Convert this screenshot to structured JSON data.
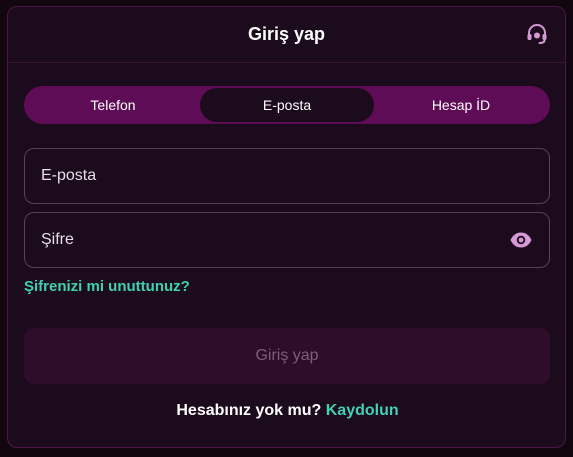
{
  "header": {
    "title": "Giriş yap",
    "support_icon": "headset-icon"
  },
  "tabs": [
    {
      "label": "Telefon",
      "active": false
    },
    {
      "label": "E-posta",
      "active": true
    },
    {
      "label": "Hesap İD",
      "active": false
    }
  ],
  "form": {
    "email_placeholder": "E-posta",
    "password_placeholder": "Şifre",
    "eye_icon": "eye-icon",
    "forgot_label": "Şifrenizi mi unuttunuz?",
    "submit_label": "Giriş yap"
  },
  "footer": {
    "prompt": "Hesabınız yok mu?",
    "link": "Kaydolun"
  },
  "colors": {
    "background": "#1c0a1d",
    "tab_bar": "#5e0c55",
    "accent_link": "#3fd1b0",
    "submit_bg": "#2e0d2b",
    "icon_tint": "#d59ad3"
  }
}
